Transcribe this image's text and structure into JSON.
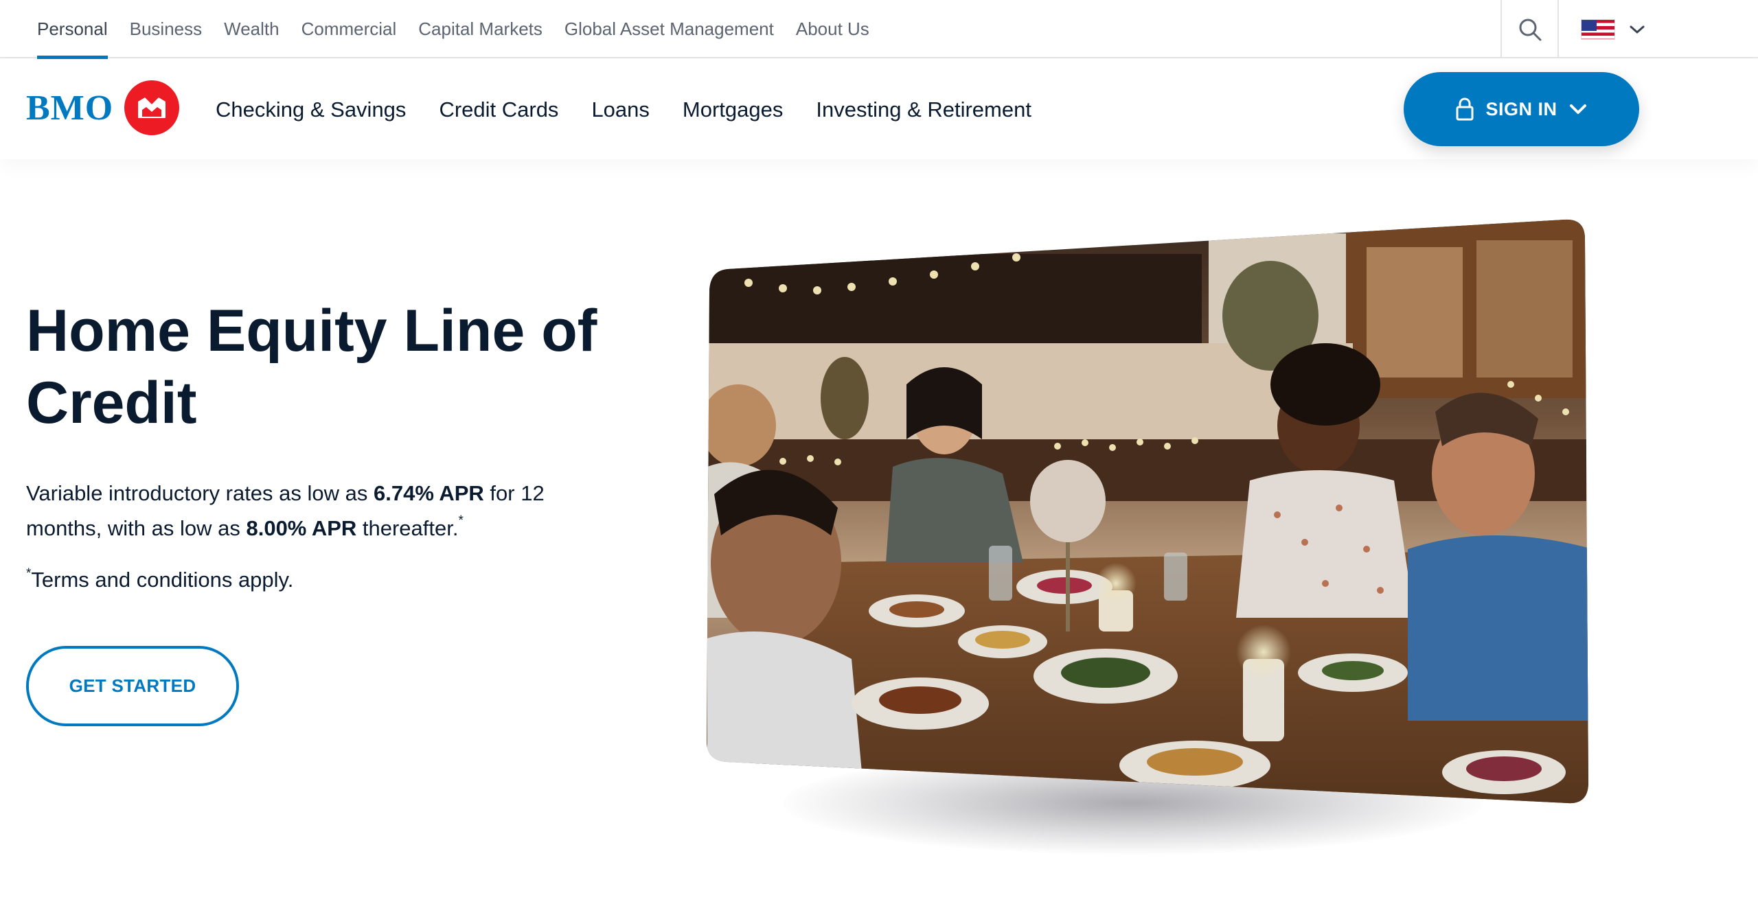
{
  "top_nav": {
    "tabs": [
      {
        "label": "Personal",
        "active": true
      },
      {
        "label": "Business",
        "active": false
      },
      {
        "label": "Wealth",
        "active": false
      },
      {
        "label": "Commercial",
        "active": false
      },
      {
        "label": "Capital Markets",
        "active": false
      },
      {
        "label": "Global Asset Management",
        "active": false
      },
      {
        "label": "About Us",
        "active": false
      }
    ],
    "search_icon": "search-icon",
    "country_flag": "us-flag",
    "country_dropdown_icon": "chevron-down-icon"
  },
  "main_nav": {
    "logo_text": "BMO",
    "links": [
      {
        "label": "Checking & Savings"
      },
      {
        "label": "Credit Cards"
      },
      {
        "label": "Loans"
      },
      {
        "label": "Mortgages"
      },
      {
        "label": "Investing & Retirement"
      }
    ],
    "sign_in": {
      "label": "SIGN IN",
      "icon": "lock-icon",
      "caret": "chevron-down-icon"
    }
  },
  "hero": {
    "title": "Home Equity Line of Credit",
    "desc_part1": "Variable introductory rates as low as ",
    "rate_intro": "6.74% APR",
    "desc_part2": " for 12 months, with as low as ",
    "rate_after": "8.00% APR",
    "desc_part3": " thereafter.",
    "asterisk": "*",
    "terms": "Terms and conditions apply.",
    "cta_label": "GET STARTED",
    "image_subject": "friends-dining-photo"
  },
  "colors": {
    "brand_blue": "#0079c1",
    "brand_red": "#ed1c24",
    "text_dark": "#0a1a2f"
  }
}
